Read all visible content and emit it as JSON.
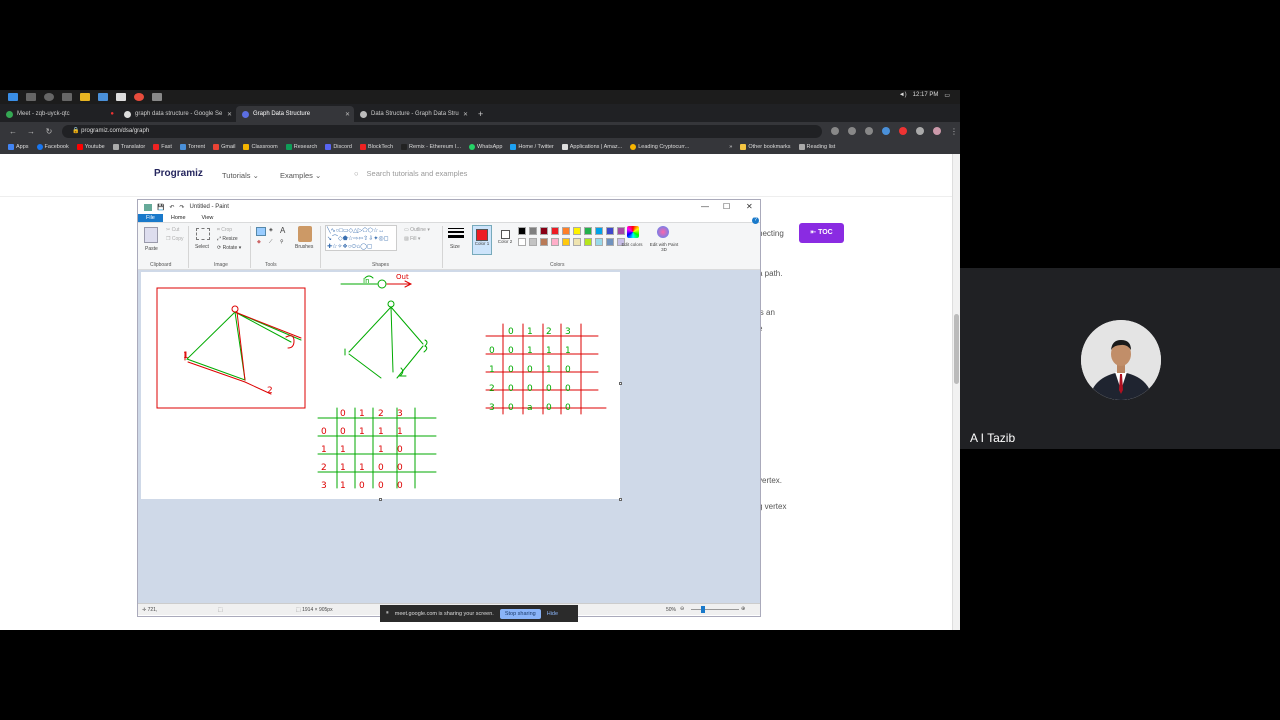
{
  "taskbar": {
    "time": "12:17 PM"
  },
  "tabs": [
    {
      "label": "Meet - zqb-uyck-qtc"
    },
    {
      "label": "graph data structure - Google Se"
    },
    {
      "label": "Graph Data Structure"
    },
    {
      "label": "Data Structure - Graph Data Stru"
    }
  ],
  "address": {
    "url": "programiz.com/dsa/graph"
  },
  "bookmarks": [
    "Apps",
    "Facebook",
    "Youtube",
    "Translator",
    "Fast",
    "Torrent",
    "Gmail",
    "Classroom",
    "Research",
    "Discord",
    "BlockTech",
    "Remix - Ethereum I...",
    "WhatsApp",
    "Home / Twitter",
    "Applications | Amaz...",
    "Leading Cryptocurr...",
    "Other bookmarks",
    "Reading list"
  ],
  "site": {
    "logo": "Programiz",
    "nav_tutorials": "Tutorials",
    "nav_examples": "Examples",
    "search_placeholder": "Search tutorials and examples",
    "toc": "TOC",
    "fragments": [
      "necting",
      "a path.",
      "is an",
      "e",
      "vertex.",
      "g vertex"
    ]
  },
  "paint": {
    "title": "Untitled - Paint",
    "menu": {
      "file": "File",
      "home": "Home",
      "view": "View"
    },
    "ribbon": {
      "paste": "Paste",
      "cut": "Cut",
      "copy": "Copy",
      "crop": "Crop",
      "resize": "Resize",
      "rotate": "Rotate",
      "select": "Select",
      "brushes": "Brushes",
      "outline": "Outline",
      "fill": "Fill",
      "size": "Size",
      "color1": "Color 1",
      "color2": "Color 2",
      "edit_colors": "Edit colors",
      "edit_paint3d": "Edit with Paint 3D",
      "groups": {
        "clipboard": "Clipboard",
        "image": "Image",
        "tools": "Tools",
        "shapes": "Shapes",
        "colors": "Colors"
      }
    },
    "palette": [
      "#000000",
      "#7f7f7f",
      "#880015",
      "#ed1c24",
      "#ff7f27",
      "#fff200",
      "#22b14c",
      "#00a2e8",
      "#3f48cc",
      "#a349a4",
      "#ffffff",
      "#c3c3c3",
      "#b97a57",
      "#ffaec9",
      "#ffc90e",
      "#efe4b0",
      "#b5e61d",
      "#99d9ea",
      "#7092be",
      "#c8bfe7"
    ],
    "status": {
      "cursor": "721,",
      "size": "1914 × 905px",
      "zoom": "50%"
    },
    "canvas": {
      "graph2_in": "In",
      "graph2_out": "Out",
      "matrix1": {
        "header": [
          "0",
          "1",
          "2",
          "3"
        ],
        "rows": [
          [
            "0",
            "0",
            "1",
            "1",
            "1"
          ],
          [
            "1",
            "0",
            "0",
            "1",
            "0"
          ],
          [
            "2",
            "0",
            "0",
            "0",
            "0"
          ],
          [
            "3",
            "0",
            "a",
            "0",
            "0"
          ]
        ]
      },
      "matrix2": {
        "header": [
          "0",
          "1",
          "2",
          "3"
        ],
        "rows": [
          [
            "0",
            "0",
            "1",
            "1",
            "1"
          ],
          [
            "1",
            "1",
            "",
            "1",
            "0"
          ],
          [
            "2",
            "1",
            "1",
            "0",
            "0"
          ],
          [
            "3",
            "1",
            "0",
            "0",
            "0"
          ]
        ]
      }
    }
  },
  "share": {
    "message": "meet.google.com is sharing your screen.",
    "stop": "Stop sharing",
    "hide": "Hide"
  },
  "meet": {
    "participant": "A I Tazib"
  }
}
